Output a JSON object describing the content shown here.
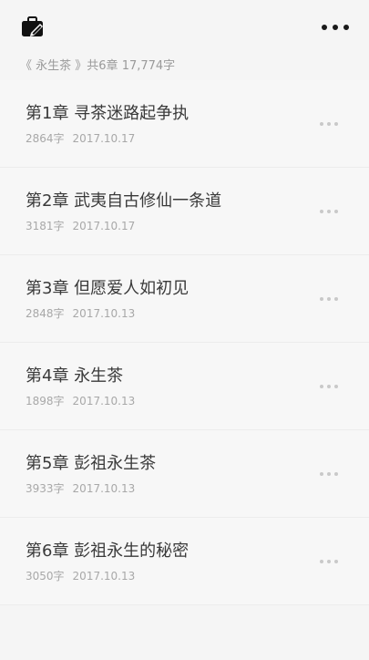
{
  "header": {
    "app_icon": "briefcase-pen-icon",
    "more_icon": "more-horizontal-icon"
  },
  "summary": {
    "book_title": "《 永生茶 》",
    "chapter_count": "共6章",
    "word_total": "17,774字"
  },
  "chapters": [
    {
      "title": "第1章 寻茶迷路起争执",
      "words": "2864字",
      "date": "2017.10.17"
    },
    {
      "title": "第2章 武夷自古修仙一条道",
      "words": "3181字",
      "date": "2017.10.17"
    },
    {
      "title": "第3章 但愿爱人如初见",
      "words": "2848字",
      "date": "2017.10.13"
    },
    {
      "title": "第4章 永生茶",
      "words": "1898字",
      "date": "2017.10.13"
    },
    {
      "title": "第5章 彭祖永生茶",
      "words": "3933字",
      "date": "2017.10.13"
    },
    {
      "title": "第6章 彭祖永生的秘密",
      "words": "3050字",
      "date": "2017.10.13"
    }
  ]
}
